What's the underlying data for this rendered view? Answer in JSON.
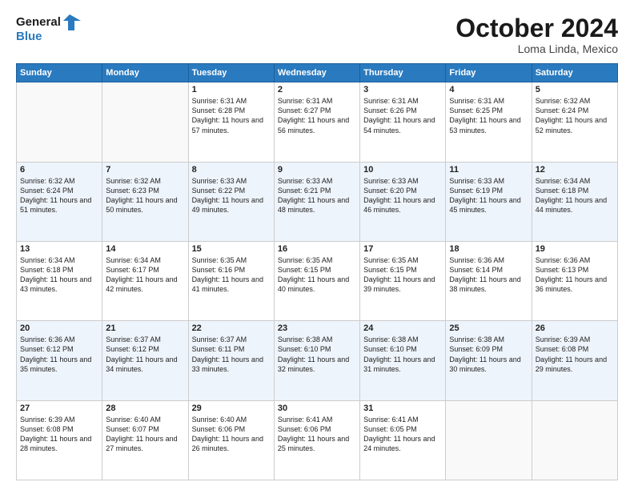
{
  "header": {
    "logo_line1": "General",
    "logo_line2": "Blue",
    "month": "October 2024",
    "location": "Loma Linda, Mexico"
  },
  "days_of_week": [
    "Sunday",
    "Monday",
    "Tuesday",
    "Wednesday",
    "Thursday",
    "Friday",
    "Saturday"
  ],
  "weeks": [
    [
      {
        "day": "",
        "info": ""
      },
      {
        "day": "",
        "info": ""
      },
      {
        "day": "1",
        "sunrise": "6:31 AM",
        "sunset": "6:28 PM",
        "daylight": "11 hours and 57 minutes."
      },
      {
        "day": "2",
        "sunrise": "6:31 AM",
        "sunset": "6:27 PM",
        "daylight": "11 hours and 56 minutes."
      },
      {
        "day": "3",
        "sunrise": "6:31 AM",
        "sunset": "6:26 PM",
        "daylight": "11 hours and 54 minutes."
      },
      {
        "day": "4",
        "sunrise": "6:31 AM",
        "sunset": "6:25 PM",
        "daylight": "11 hours and 53 minutes."
      },
      {
        "day": "5",
        "sunrise": "6:32 AM",
        "sunset": "6:24 PM",
        "daylight": "11 hours and 52 minutes."
      }
    ],
    [
      {
        "day": "6",
        "sunrise": "6:32 AM",
        "sunset": "6:24 PM",
        "daylight": "11 hours and 51 minutes."
      },
      {
        "day": "7",
        "sunrise": "6:32 AM",
        "sunset": "6:23 PM",
        "daylight": "11 hours and 50 minutes."
      },
      {
        "day": "8",
        "sunrise": "6:33 AM",
        "sunset": "6:22 PM",
        "daylight": "11 hours and 49 minutes."
      },
      {
        "day": "9",
        "sunrise": "6:33 AM",
        "sunset": "6:21 PM",
        "daylight": "11 hours and 48 minutes."
      },
      {
        "day": "10",
        "sunrise": "6:33 AM",
        "sunset": "6:20 PM",
        "daylight": "11 hours and 46 minutes."
      },
      {
        "day": "11",
        "sunrise": "6:33 AM",
        "sunset": "6:19 PM",
        "daylight": "11 hours and 45 minutes."
      },
      {
        "day": "12",
        "sunrise": "6:34 AM",
        "sunset": "6:18 PM",
        "daylight": "11 hours and 44 minutes."
      }
    ],
    [
      {
        "day": "13",
        "sunrise": "6:34 AM",
        "sunset": "6:18 PM",
        "daylight": "11 hours and 43 minutes."
      },
      {
        "day": "14",
        "sunrise": "6:34 AM",
        "sunset": "6:17 PM",
        "daylight": "11 hours and 42 minutes."
      },
      {
        "day": "15",
        "sunrise": "6:35 AM",
        "sunset": "6:16 PM",
        "daylight": "11 hours and 41 minutes."
      },
      {
        "day": "16",
        "sunrise": "6:35 AM",
        "sunset": "6:15 PM",
        "daylight": "11 hours and 40 minutes."
      },
      {
        "day": "17",
        "sunrise": "6:35 AM",
        "sunset": "6:15 PM",
        "daylight": "11 hours and 39 minutes."
      },
      {
        "day": "18",
        "sunrise": "6:36 AM",
        "sunset": "6:14 PM",
        "daylight": "11 hours and 38 minutes."
      },
      {
        "day": "19",
        "sunrise": "6:36 AM",
        "sunset": "6:13 PM",
        "daylight": "11 hours and 36 minutes."
      }
    ],
    [
      {
        "day": "20",
        "sunrise": "6:36 AM",
        "sunset": "6:12 PM",
        "daylight": "11 hours and 35 minutes."
      },
      {
        "day": "21",
        "sunrise": "6:37 AM",
        "sunset": "6:12 PM",
        "daylight": "11 hours and 34 minutes."
      },
      {
        "day": "22",
        "sunrise": "6:37 AM",
        "sunset": "6:11 PM",
        "daylight": "11 hours and 33 minutes."
      },
      {
        "day": "23",
        "sunrise": "6:38 AM",
        "sunset": "6:10 PM",
        "daylight": "11 hours and 32 minutes."
      },
      {
        "day": "24",
        "sunrise": "6:38 AM",
        "sunset": "6:10 PM",
        "daylight": "11 hours and 31 minutes."
      },
      {
        "day": "25",
        "sunrise": "6:38 AM",
        "sunset": "6:09 PM",
        "daylight": "11 hours and 30 minutes."
      },
      {
        "day": "26",
        "sunrise": "6:39 AM",
        "sunset": "6:08 PM",
        "daylight": "11 hours and 29 minutes."
      }
    ],
    [
      {
        "day": "27",
        "sunrise": "6:39 AM",
        "sunset": "6:08 PM",
        "daylight": "11 hours and 28 minutes."
      },
      {
        "day": "28",
        "sunrise": "6:40 AM",
        "sunset": "6:07 PM",
        "daylight": "11 hours and 27 minutes."
      },
      {
        "day": "29",
        "sunrise": "6:40 AM",
        "sunset": "6:06 PM",
        "daylight": "11 hours and 26 minutes."
      },
      {
        "day": "30",
        "sunrise": "6:41 AM",
        "sunset": "6:06 PM",
        "daylight": "11 hours and 25 minutes."
      },
      {
        "day": "31",
        "sunrise": "6:41 AM",
        "sunset": "6:05 PM",
        "daylight": "11 hours and 24 minutes."
      },
      {
        "day": "",
        "info": ""
      },
      {
        "day": "",
        "info": ""
      }
    ]
  ]
}
